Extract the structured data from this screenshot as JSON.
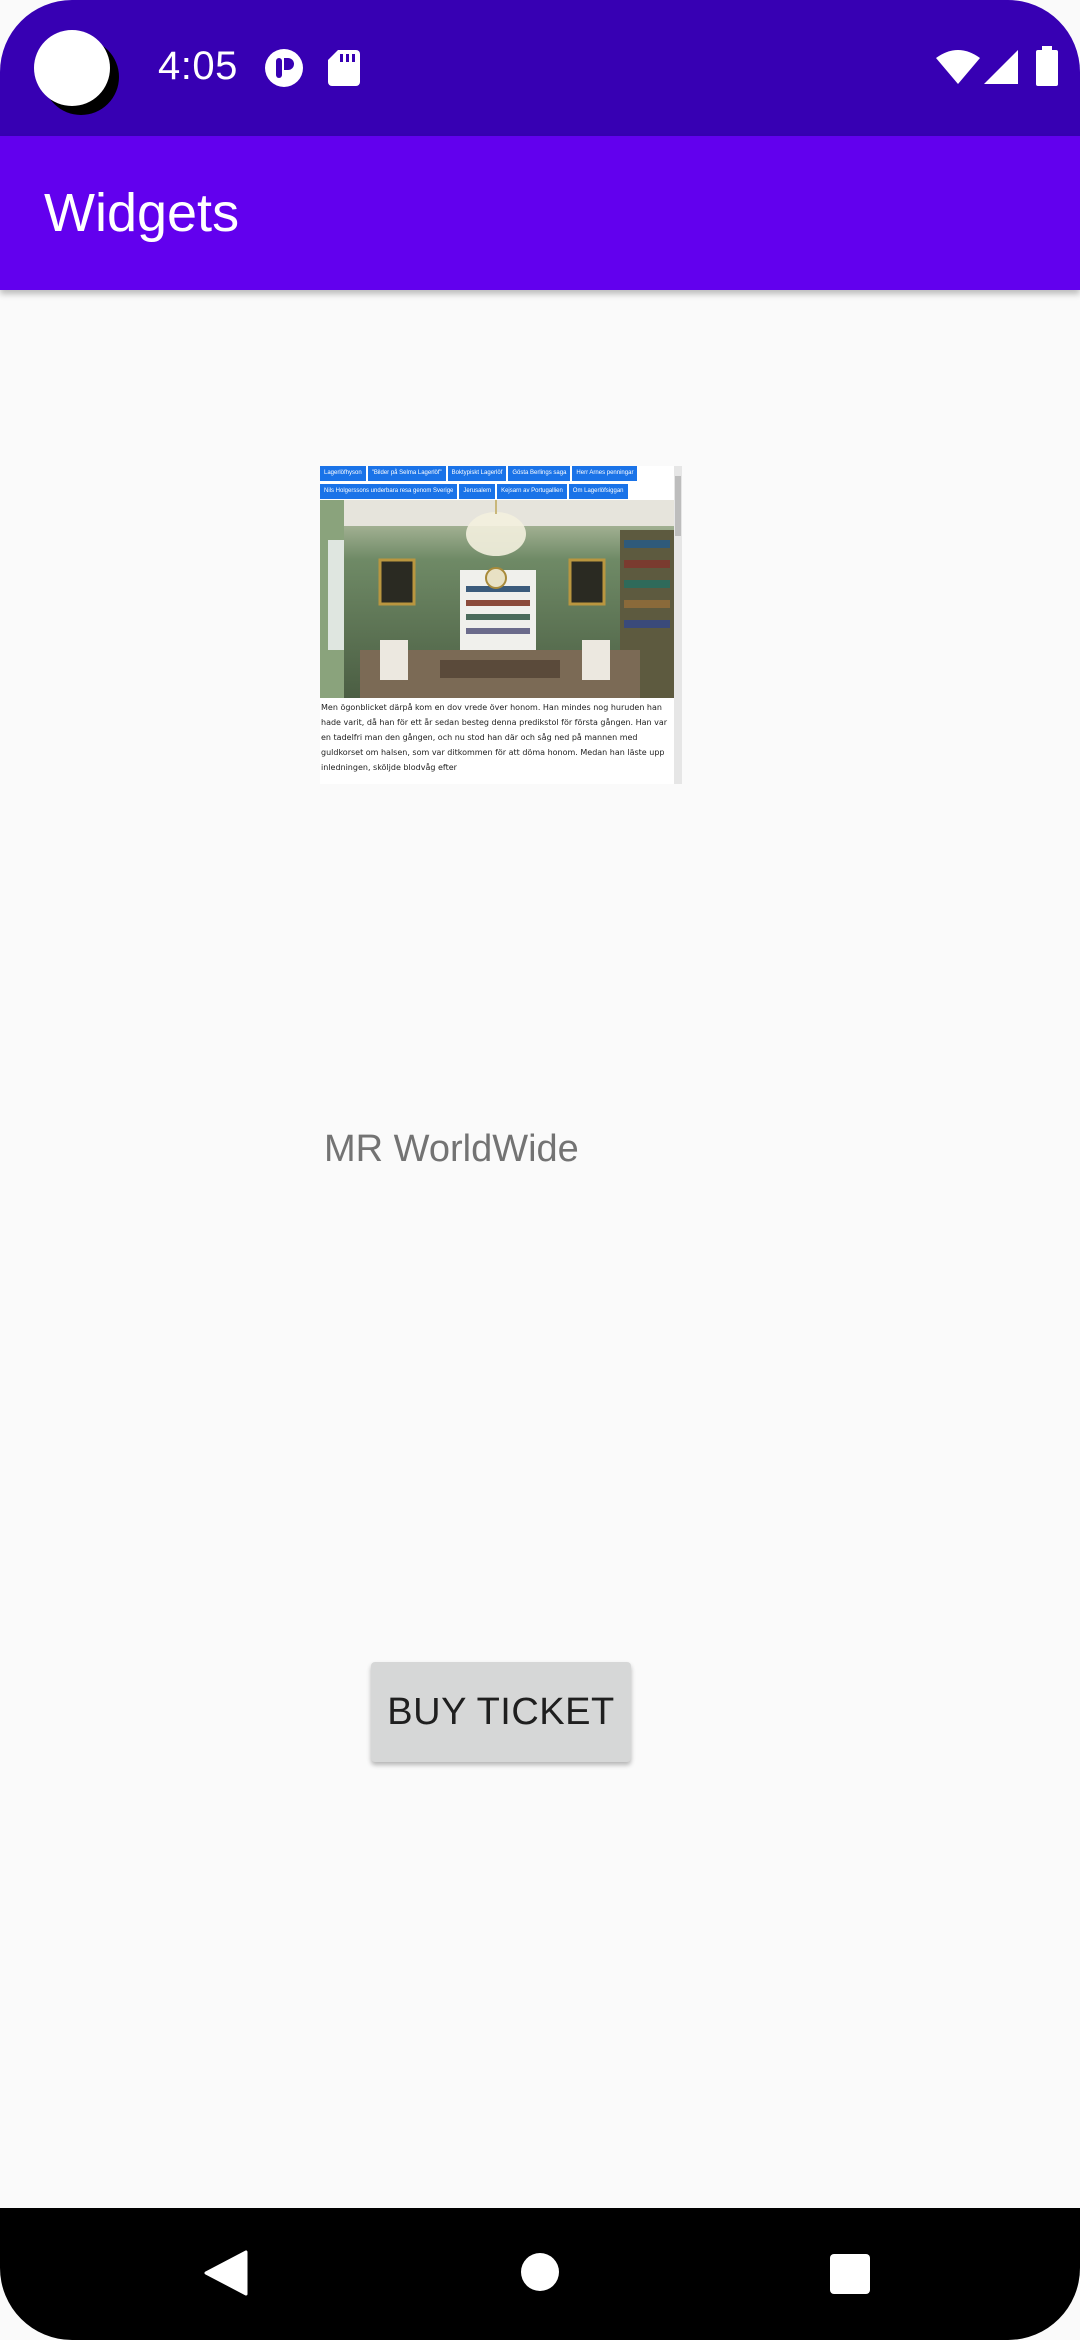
{
  "status_bar": {
    "time": "4:05",
    "icons": [
      "camera-cutout",
      "app-notification-icon",
      "sd-card-icon",
      "wifi-icon",
      "cell-signal-icon",
      "battery-icon"
    ]
  },
  "app_bar": {
    "title": "Widgets"
  },
  "webview": {
    "nav_links": [
      "Lagerlöfhyson",
      "\"Bilder på Selma Lagerlöf\"",
      "Boktypiskt Lagerlöf",
      "Gösta Berlings saga",
      "Herr Arnes penningar",
      "Nils Holgerssons underbara resa genom Sverige",
      "Jerusalem",
      "Kejsarn av Portugallien",
      "Om Lagerlöfsiggan"
    ],
    "body_text": "Men ögonblicket därpå kom en dov vrede över honom. Han mindes nog huruden han hade varit, då han för ett år sedan besteg denna predikstol för första gången. Han var en tadelfri man den gången, och nu stod han där och såg ned på mannen med guldkorset om halsen, som var ditkommen för att döma honom. Medan han läste upp inledningen, sköljde blodvåg efter",
    "photo_description_icon": "photo-image"
  },
  "label": {
    "text": "MR WorldWide"
  },
  "button": {
    "label": "BUY TICKET"
  },
  "nav_bar": {
    "back": "back-icon",
    "home": "home-icon",
    "recents": "recents-icon"
  },
  "colors": {
    "status_bar": "#3700b3",
    "app_bar": "#6200ee",
    "background": "#fafafa",
    "button": "#d6d7d7",
    "label": "#737373"
  }
}
